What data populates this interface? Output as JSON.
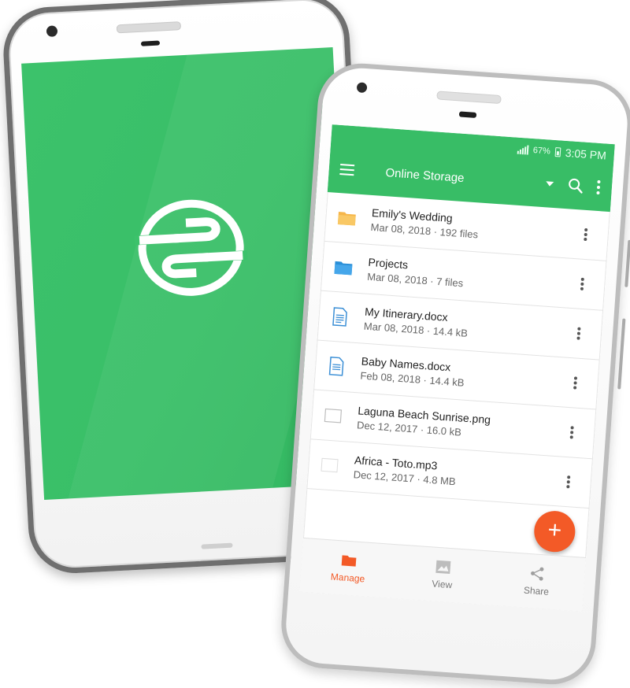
{
  "splash": {
    "brand_color": "#3cc26b"
  },
  "statusbar": {
    "battery": "67%",
    "time": "3:05 PM"
  },
  "appbar": {
    "title": "Online Storage",
    "color": "#38bd66"
  },
  "files": [
    {
      "name": "Emily's Wedding",
      "meta": "Mar 08, 2018 · 192 files",
      "icon": "folder-orange-icon"
    },
    {
      "name": "Projects",
      "meta": "Mar 08, 2018 · 7 files",
      "icon": "folder-blue-icon"
    },
    {
      "name": "My Itinerary.docx",
      "meta": "Mar 08, 2018 · 14.4 kB",
      "icon": "document-icon"
    },
    {
      "name": "Baby Names.docx",
      "meta": "Feb 08, 2018 · 14.4 kB",
      "icon": "document-icon"
    },
    {
      "name": "Laguna Beach Sunrise.png",
      "meta": "Dec 12, 2017 · 16.0 kB",
      "icon": "image-icon"
    },
    {
      "name": "Africa - Toto.mp3",
      "meta": "Dec 12, 2017 · 4.8 MB",
      "icon": "audio-icon"
    }
  ],
  "fab": {
    "label": "+",
    "color": "#f35a27"
  },
  "bottomnav": [
    {
      "label": "Manage",
      "active": true
    },
    {
      "label": "View",
      "active": false
    },
    {
      "label": "Share",
      "active": false
    }
  ]
}
